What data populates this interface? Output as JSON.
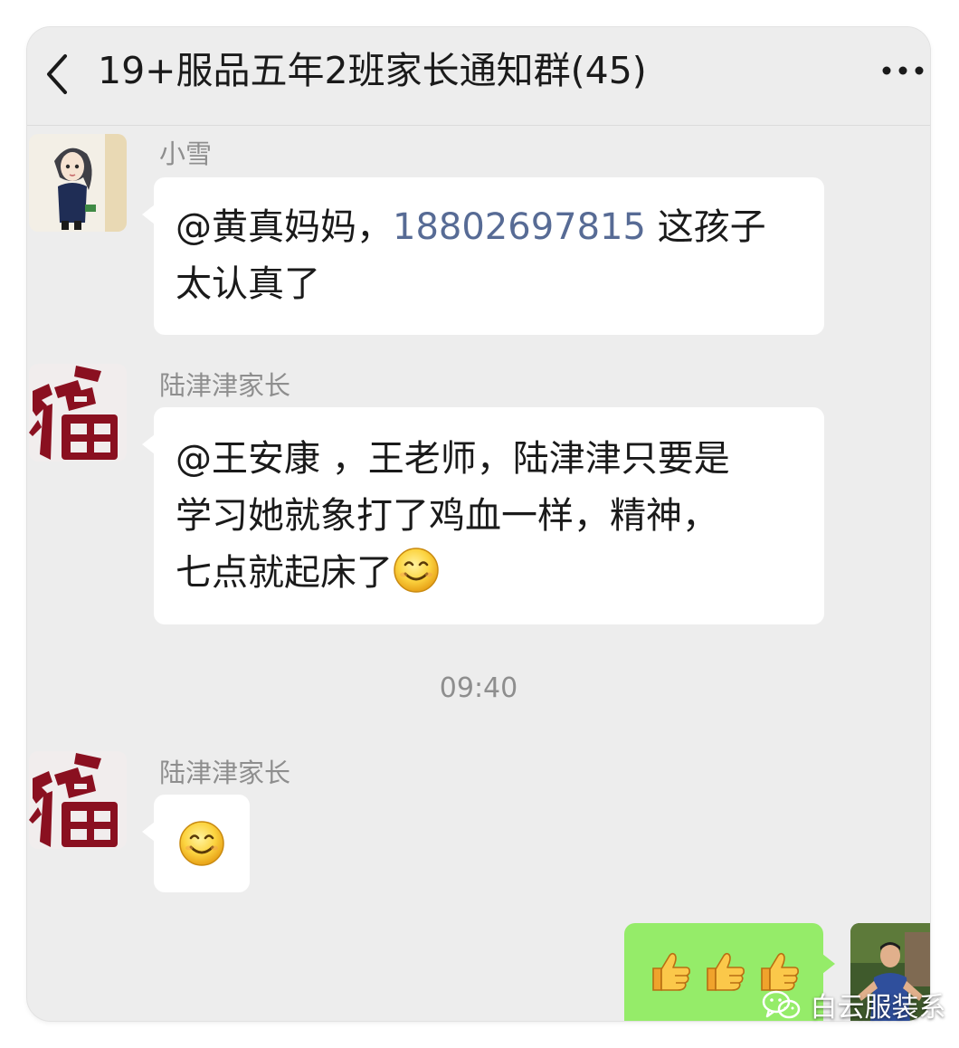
{
  "header": {
    "title": "19+服品五年2班家长通知群(45)",
    "back_icon": "chevron-left-icon",
    "more_icon": "ellipsis-icon"
  },
  "messages": [
    {
      "sender": "小雪",
      "avatar": "anime-girl-avatar",
      "text_line1_a": "@黄真妈妈，",
      "phone": "18802697815",
      "text_line1_b": " 这孩子",
      "text_line2": "太认真了"
    },
    {
      "sender": "陆津津家长",
      "avatar": "fu-character-avatar",
      "line1": "@王安康 ，王老师，陆津津只要是",
      "line2": "学习她就象打了鸡血一样，精神，",
      "line3": "七点就起床了",
      "emoji": "smiley-icon"
    },
    {
      "sender": "陆津津家长",
      "avatar": "fu-character-avatar",
      "emoji": "smiley-icon"
    },
    {
      "from": "me",
      "avatar": "photo-man-avatar",
      "emojis": [
        "thumbs-up-icon",
        "thumbs-up-icon",
        "thumbs-up-icon"
      ]
    }
  ],
  "timestamp": "09:40",
  "watermark": {
    "text": "白云服装系",
    "icon": "wechat-icon"
  },
  "colors": {
    "background": "#ededed",
    "bubble_in": "#ffffff",
    "bubble_out": "#95ec69",
    "link": "#576b95",
    "sender_name": "#8e8e8e"
  }
}
